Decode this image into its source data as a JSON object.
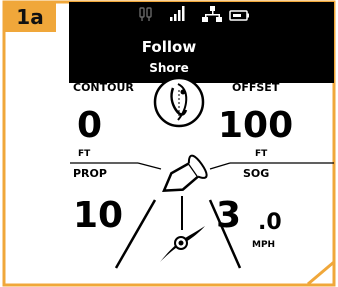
{
  "figure_label": "1a",
  "header": {
    "mode_title": "Follow",
    "mode_subtitle": "Shore"
  },
  "status_icons": [
    "gps-icon",
    "signal-bars-icon",
    "network-icon",
    "battery-icon"
  ],
  "contour": {
    "label": "CONTOUR",
    "value": "0",
    "unit": "FT"
  },
  "offset": {
    "label": "OFFSET",
    "value": "100",
    "unit": "FT"
  },
  "prop": {
    "label": "PROP",
    "value": "10"
  },
  "sog": {
    "label": "SOG",
    "value_int": "3",
    "value_dec": ".0",
    "unit": "MPH"
  },
  "colors": {
    "accent": "#f0a73a",
    "screen_bg": "#ffffff",
    "header_bg": "#000000",
    "text": "#000000"
  }
}
